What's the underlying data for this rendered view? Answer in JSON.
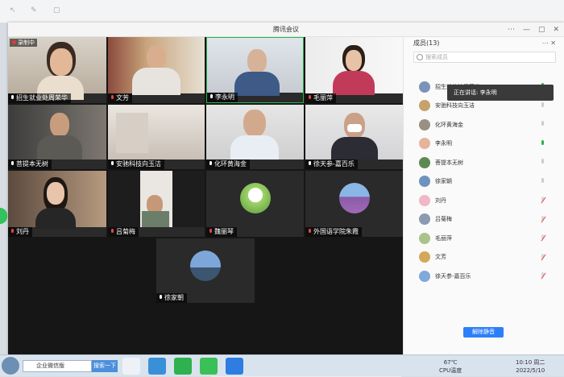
{
  "window": {
    "title": "腾讯会议"
  },
  "grid": {
    "recording_label": "录制中",
    "tiles": [
      {
        "name": "招生就业处周荣华",
        "muted": false,
        "kind": "cam"
      },
      {
        "name": "文芳",
        "muted": true,
        "kind": "cam"
      },
      {
        "name": "李永明",
        "muted": false,
        "kind": "cam"
      },
      {
        "name": "毛丽萍",
        "muted": true,
        "kind": "cam"
      },
      {
        "name": "菩提本无树",
        "muted": false,
        "kind": "cam"
      },
      {
        "name": "安驰科技向玉洁",
        "muted": false,
        "kind": "cam"
      },
      {
        "name": "化环黄海金",
        "muted": false,
        "kind": "cam"
      },
      {
        "name": "徐天参-嘉百乐",
        "muted": false,
        "kind": "cam"
      },
      {
        "name": "刘丹",
        "muted": true,
        "kind": "cam"
      },
      {
        "name": "吕菊梅",
        "muted": true,
        "kind": "cam"
      },
      {
        "name": "魏丽琴",
        "muted": true,
        "kind": "avatar"
      },
      {
        "name": "外国语学院朱霞",
        "muted": true,
        "kind": "avatar"
      },
      {
        "name": "徐家朝",
        "muted": false,
        "kind": "avatar"
      }
    ]
  },
  "panel": {
    "title": "成员(13)",
    "search_placeholder": "搜索成员",
    "speaking_label": "正在讲话: 李永明",
    "mute_all_label": "解除静音",
    "members": [
      {
        "name": "招生就业处周荣华",
        "mic": "on"
      },
      {
        "name": "安驰科技向玉洁",
        "mic": "idle"
      },
      {
        "name": "化环黄海金",
        "mic": "idle"
      },
      {
        "name": "李永明",
        "mic": "on"
      },
      {
        "name": "菩提本无树",
        "mic": "idle"
      },
      {
        "name": "徐家朝",
        "mic": "idle"
      },
      {
        "name": "刘丹",
        "mic": "off"
      },
      {
        "name": "吕菊梅",
        "mic": "off"
      },
      {
        "name": "毛丽萍",
        "mic": "off"
      },
      {
        "name": "文芳",
        "mic": "off"
      },
      {
        "name": "徐天参-嘉百乐",
        "mic": "off"
      }
    ]
  },
  "taskbar": {
    "search_text": "企业微信版",
    "search_button": "搜索一下",
    "temp": "67℃",
    "cpu_label": "CPU温度",
    "time": "10:10 周二",
    "date": "2022/5/10"
  }
}
